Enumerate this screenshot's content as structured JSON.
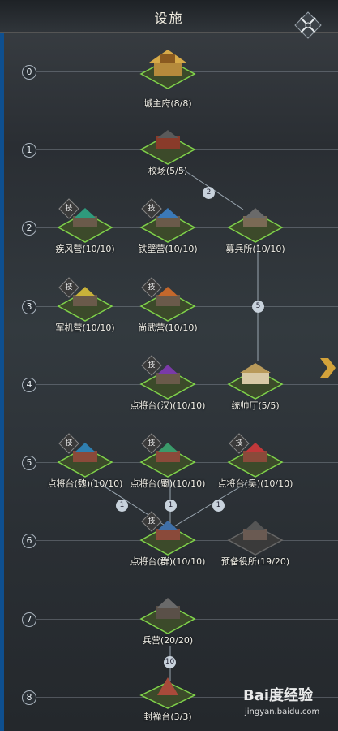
{
  "header": {
    "title": "设施",
    "close_icon": "crossed-swords-close-icon"
  },
  "side_arrow_icon": "chevron-right-icon",
  "tiers": [
    "0",
    "1",
    "2",
    "3",
    "4",
    "5",
    "6",
    "7",
    "8"
  ],
  "badge_text": "技",
  "buildings": {
    "city_lord": "城主府(8/8)",
    "drill_ground": "校场(5/5)",
    "jifeng": "疾风营(10/10)",
    "tiebi": "铁壁营(10/10)",
    "recruit": "募兵所(10/10)",
    "junji": "军机营(10/10)",
    "shangwu": "尚武营(10/10)",
    "han": "点将台(汉)(10/10)",
    "marshal": "统帅厅(5/5)",
    "wei": "点将台(魏)(10/10)",
    "shu": "点将台(蜀)(10/10)",
    "wu": "点将台(吴)(10/10)",
    "qun": "点将台(群)(10/10)",
    "reserve": "预备役所(19/20)",
    "barracks": "兵营(20/20)",
    "fengshan": "封禅台(3/3)"
  },
  "link_requirements": {
    "drill_to_recruit": "2",
    "recruit_to_marshal": "5",
    "wei_to_qun": "1",
    "shu_to_qun": "1",
    "wu_to_qun": "1",
    "barracks_to_fengshan": "10"
  },
  "roof_colors": {
    "jifeng": "#2f9a7c",
    "tiebi": "#3b79b8",
    "junji": "#c9b23a",
    "shangwu": "#c4682c",
    "han": "#7a3aa8",
    "wei": "#2f7fb0",
    "shu": "#3a9a6a",
    "wu": "#c0383a",
    "qun": "#3f6fa8",
    "recruit": "#6a6a6a",
    "marshal": "#d8c9a6",
    "reserve": "#555"
  },
  "watermark": {
    "logo": "Bai度经验",
    "url": "jingyan.baidu.com"
  }
}
